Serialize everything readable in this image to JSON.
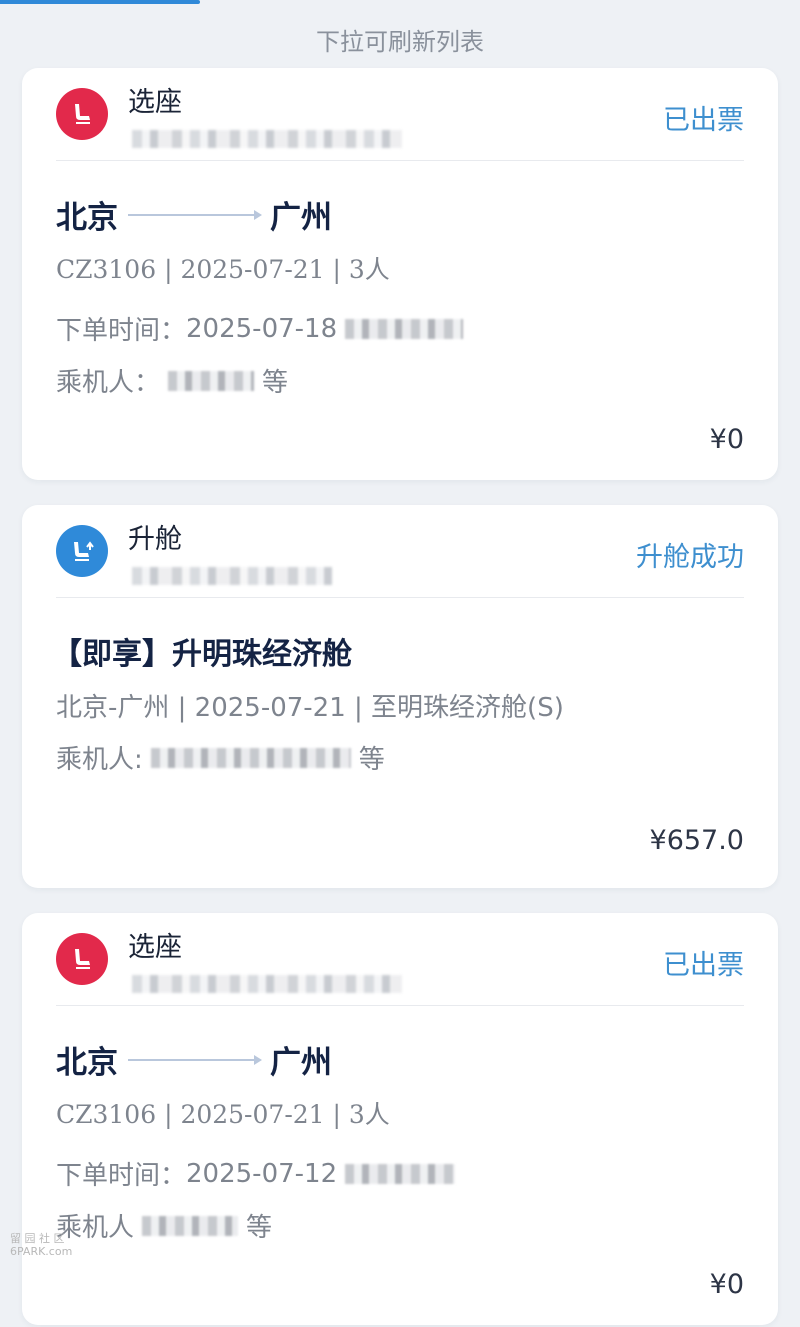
{
  "refresh_hint": "下拉可刷新列表",
  "orders": [
    {
      "type": "选座",
      "icon": "seat-icon",
      "status": "已出票",
      "from": "北京",
      "to": "广州",
      "flight_info": "CZ3106 | 2025-07-21 | 3人",
      "order_time_label": "下单时间：",
      "order_time": "2025-07-18",
      "passenger_label": "乘机人：",
      "passenger_suffix": "等",
      "price": "¥0"
    },
    {
      "type": "升舱",
      "icon": "upgrade-seat-icon",
      "status": "升舱成功",
      "title": "【即享】升明珠经济舱",
      "detail": "北京-广州 | 2025-07-21 | 至明珠经济舱(S)",
      "passenger_label": "乘机人:",
      "passenger_suffix": "等",
      "price": "¥657.0"
    },
    {
      "type": "选座",
      "icon": "seat-icon",
      "status": "已出票",
      "from": "北京",
      "to": "广州",
      "flight_info": "CZ3106 | 2025-07-21 | 3人",
      "order_time_label": "下单时间：",
      "order_time": "2025-07-12",
      "passenger_label": "乘机人",
      "passenger_suffix": "等",
      "price": "¥0"
    }
  ],
  "watermark": {
    "line1": "留 园 社 区",
    "line2": "6PARK.com"
  },
  "colors": {
    "accent_blue": "#3e8fcf",
    "seat_red": "#e2294b",
    "upgrade_blue": "#2f8ad9"
  }
}
